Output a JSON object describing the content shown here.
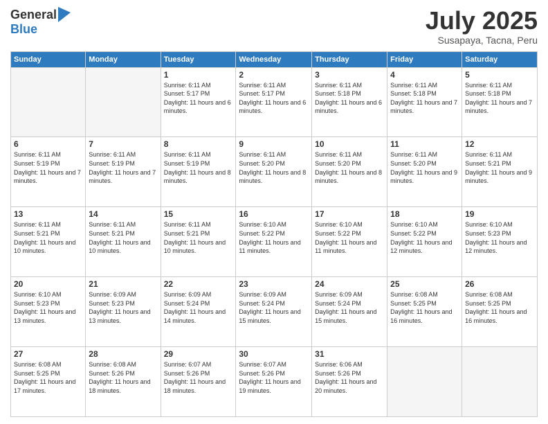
{
  "logo": {
    "line1": "General",
    "line2": "Blue"
  },
  "title": "July 2025",
  "subtitle": "Susapaya, Tacna, Peru",
  "weekdays": [
    "Sunday",
    "Monday",
    "Tuesday",
    "Wednesday",
    "Thursday",
    "Friday",
    "Saturday"
  ],
  "weeks": [
    [
      {
        "day": "",
        "empty": true
      },
      {
        "day": "",
        "empty": true
      },
      {
        "day": "1",
        "sunrise": "6:11 AM",
        "sunset": "5:17 PM",
        "daylight": "11 hours and 6 minutes."
      },
      {
        "day": "2",
        "sunrise": "6:11 AM",
        "sunset": "5:17 PM",
        "daylight": "11 hours and 6 minutes."
      },
      {
        "day": "3",
        "sunrise": "6:11 AM",
        "sunset": "5:18 PM",
        "daylight": "11 hours and 6 minutes."
      },
      {
        "day": "4",
        "sunrise": "6:11 AM",
        "sunset": "5:18 PM",
        "daylight": "11 hours and 7 minutes."
      },
      {
        "day": "5",
        "sunrise": "6:11 AM",
        "sunset": "5:18 PM",
        "daylight": "11 hours and 7 minutes."
      }
    ],
    [
      {
        "day": "6",
        "sunrise": "6:11 AM",
        "sunset": "5:19 PM",
        "daylight": "11 hours and 7 minutes."
      },
      {
        "day": "7",
        "sunrise": "6:11 AM",
        "sunset": "5:19 PM",
        "daylight": "11 hours and 7 minutes."
      },
      {
        "day": "8",
        "sunrise": "6:11 AM",
        "sunset": "5:19 PM",
        "daylight": "11 hours and 8 minutes."
      },
      {
        "day": "9",
        "sunrise": "6:11 AM",
        "sunset": "5:20 PM",
        "daylight": "11 hours and 8 minutes."
      },
      {
        "day": "10",
        "sunrise": "6:11 AM",
        "sunset": "5:20 PM",
        "daylight": "11 hours and 8 minutes."
      },
      {
        "day": "11",
        "sunrise": "6:11 AM",
        "sunset": "5:20 PM",
        "daylight": "11 hours and 9 minutes."
      },
      {
        "day": "12",
        "sunrise": "6:11 AM",
        "sunset": "5:21 PM",
        "daylight": "11 hours and 9 minutes."
      }
    ],
    [
      {
        "day": "13",
        "sunrise": "6:11 AM",
        "sunset": "5:21 PM",
        "daylight": "11 hours and 10 minutes."
      },
      {
        "day": "14",
        "sunrise": "6:11 AM",
        "sunset": "5:21 PM",
        "daylight": "11 hours and 10 minutes."
      },
      {
        "day": "15",
        "sunrise": "6:11 AM",
        "sunset": "5:21 PM",
        "daylight": "11 hours and 10 minutes."
      },
      {
        "day": "16",
        "sunrise": "6:10 AM",
        "sunset": "5:22 PM",
        "daylight": "11 hours and 11 minutes."
      },
      {
        "day": "17",
        "sunrise": "6:10 AM",
        "sunset": "5:22 PM",
        "daylight": "11 hours and 11 minutes."
      },
      {
        "day": "18",
        "sunrise": "6:10 AM",
        "sunset": "5:22 PM",
        "daylight": "11 hours and 12 minutes."
      },
      {
        "day": "19",
        "sunrise": "6:10 AM",
        "sunset": "5:23 PM",
        "daylight": "11 hours and 12 minutes."
      }
    ],
    [
      {
        "day": "20",
        "sunrise": "6:10 AM",
        "sunset": "5:23 PM",
        "daylight": "11 hours and 13 minutes."
      },
      {
        "day": "21",
        "sunrise": "6:09 AM",
        "sunset": "5:23 PM",
        "daylight": "11 hours and 13 minutes."
      },
      {
        "day": "22",
        "sunrise": "6:09 AM",
        "sunset": "5:24 PM",
        "daylight": "11 hours and 14 minutes."
      },
      {
        "day": "23",
        "sunrise": "6:09 AM",
        "sunset": "5:24 PM",
        "daylight": "11 hours and 15 minutes."
      },
      {
        "day": "24",
        "sunrise": "6:09 AM",
        "sunset": "5:24 PM",
        "daylight": "11 hours and 15 minutes."
      },
      {
        "day": "25",
        "sunrise": "6:08 AM",
        "sunset": "5:25 PM",
        "daylight": "11 hours and 16 minutes."
      },
      {
        "day": "26",
        "sunrise": "6:08 AM",
        "sunset": "5:25 PM",
        "daylight": "11 hours and 16 minutes."
      }
    ],
    [
      {
        "day": "27",
        "sunrise": "6:08 AM",
        "sunset": "5:25 PM",
        "daylight": "11 hours and 17 minutes."
      },
      {
        "day": "28",
        "sunrise": "6:08 AM",
        "sunset": "5:26 PM",
        "daylight": "11 hours and 18 minutes."
      },
      {
        "day": "29",
        "sunrise": "6:07 AM",
        "sunset": "5:26 PM",
        "daylight": "11 hours and 18 minutes."
      },
      {
        "day": "30",
        "sunrise": "6:07 AM",
        "sunset": "5:26 PM",
        "daylight": "11 hours and 19 minutes."
      },
      {
        "day": "31",
        "sunrise": "6:06 AM",
        "sunset": "5:26 PM",
        "daylight": "11 hours and 20 minutes."
      },
      {
        "day": "",
        "empty": true
      },
      {
        "day": "",
        "empty": true
      }
    ]
  ]
}
